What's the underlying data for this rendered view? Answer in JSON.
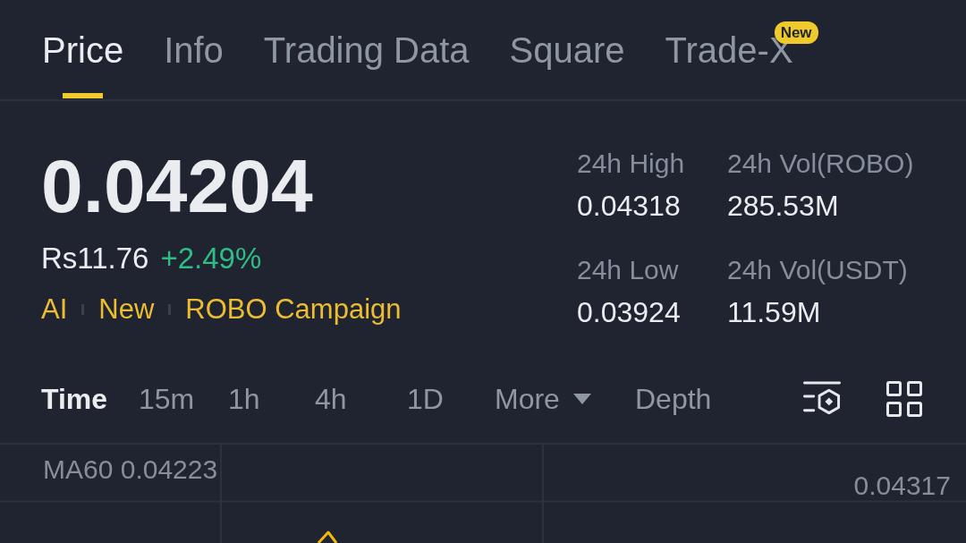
{
  "tabs": [
    {
      "label": "Price",
      "selected": true
    },
    {
      "label": "Info",
      "selected": false
    },
    {
      "label": "Trading Data",
      "selected": false
    },
    {
      "label": "Square",
      "selected": false
    },
    {
      "label": "Trade-X",
      "selected": false,
      "badge": "New"
    }
  ],
  "ticker": {
    "last_price": "0.04204",
    "fiat_price": "Rs11.76",
    "change": "+2.49%",
    "rising": true,
    "tags": [
      "AI",
      "New",
      "ROBO Campaign"
    ]
  },
  "stats": [
    {
      "label": "24h High",
      "value": "0.04318"
    },
    {
      "label": "24h Vol(ROBO)",
      "value": "285.53M"
    },
    {
      "label": "24h Low",
      "value": "0.03924"
    },
    {
      "label": "24h Vol(USDT)",
      "value": "11.59M"
    }
  ],
  "intervals": [
    {
      "label": "Time",
      "kind": "option",
      "selected": true
    },
    {
      "label": "15m",
      "kind": "option",
      "selected": false
    },
    {
      "label": "1h",
      "kind": "option",
      "selected": false
    },
    {
      "label": "4h",
      "kind": "option",
      "selected": false
    },
    {
      "label": "1D",
      "kind": "option",
      "selected": false
    },
    {
      "label": "More",
      "kind": "dropdown",
      "selected": false
    },
    {
      "label": "Depth",
      "kind": "option",
      "selected": false
    }
  ],
  "chart": {
    "indicator": "MA60 0.04223",
    "price_label": "0.04317"
  }
}
